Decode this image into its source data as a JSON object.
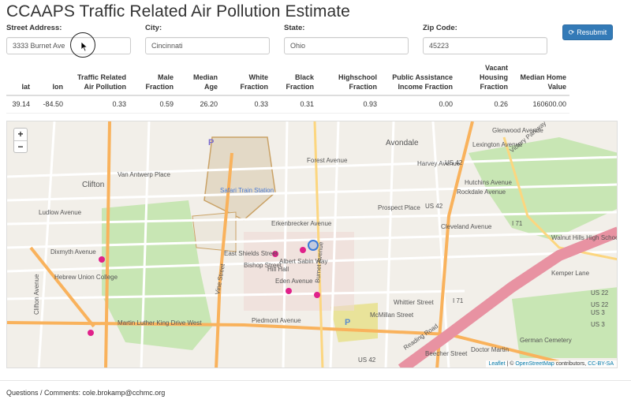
{
  "title": "CCAAPS Traffic Related Air Pollution Estimate",
  "form": {
    "street": {
      "label": "Street Address:",
      "value": "3333 Burnet Ave"
    },
    "city": {
      "label": "City:",
      "value": "Cincinnati"
    },
    "state": {
      "label": "State:",
      "value": "Ohio"
    },
    "zip": {
      "label": "Zip Code:",
      "value": "45223"
    },
    "resubmit_label": "Resubmit"
  },
  "results": {
    "headers": [
      "lat",
      "lon",
      "Traffic Related Air Pollution",
      "Male Fraction",
      "Median Age",
      "White Fraction",
      "Black Fraction",
      "Highschool Fraction",
      "Public Assistance Income Fraction",
      "Vacant Housing Fraction",
      "Median Home Value"
    ],
    "row": [
      "39.14",
      "-84.50",
      "0.33",
      "0.59",
      "26.20",
      "0.33",
      "0.31",
      "0.93",
      "0.00",
      "0.26",
      "160600.00"
    ]
  },
  "map": {
    "zoom_in": "+",
    "zoom_out": "−",
    "attribution": {
      "leaflet": "Leaflet",
      "sep": " | © ",
      "osm": "OpenStreetMap",
      "contrib": " contributors, ",
      "license": "CC-BY-SA"
    },
    "labels": {
      "avondale": "Avondale",
      "clifton": "Clifton",
      "safari": "Safari Train Station",
      "walnut_hills": "Walnut Hills High School",
      "german_cemetery": "German Cemetery",
      "us42_a": "US 42",
      "us42_b": "US 42",
      "us42_c": "US 42",
      "us22_a": "US 22",
      "us22_b": "US 22",
      "us3_a": "US 3",
      "us3_b": "US 3",
      "i71_a": "I 71",
      "i71_b": "I 71",
      "forest": "Forest Avenue",
      "rockdale": "Rockdale Avenue",
      "mlk": "Martin Luther King Drive West",
      "cleveland": "Cleveland Avenue",
      "clifton_ave": "Clifton Avenue",
      "vine": "Vine Street",
      "burnet": "Burnet Avenue",
      "reading": "Reading Road",
      "victory": "Victory Parkway",
      "dixmyth": "Dixmyth Avenue",
      "erkenbrecker": "Erkenbrecker Avenue",
      "albert_sabin": "Albert Sabin Way",
      "eden": "Eden Avenue",
      "piedmont": "Piedmont Avenue",
      "lexington": "Lexington Avenue",
      "hutchins": "Hutchins Avenue",
      "prospect": "Prospect Place",
      "ludlow": "Ludlow Avenue",
      "bishop": "Bishop Street",
      "whittier": "Whittier Street",
      "beecher": "Beecher Street",
      "doctor_martin": "Doctor Martin",
      "hebrew": "Hebrew Union College",
      "harvey": "Harvey Avenue",
      "glenwood": "Glenwood Avenue",
      "kemper": "Kemper Lane",
      "east_shields": "East Shields Street",
      "van_antwerp": "Van Antwerp Place",
      "mcmillan": "McMillan Street",
      "hill_hall": "Hill Hall"
    }
  },
  "footer": "Questions / Comments: cole.brokamp@cchmc.org"
}
